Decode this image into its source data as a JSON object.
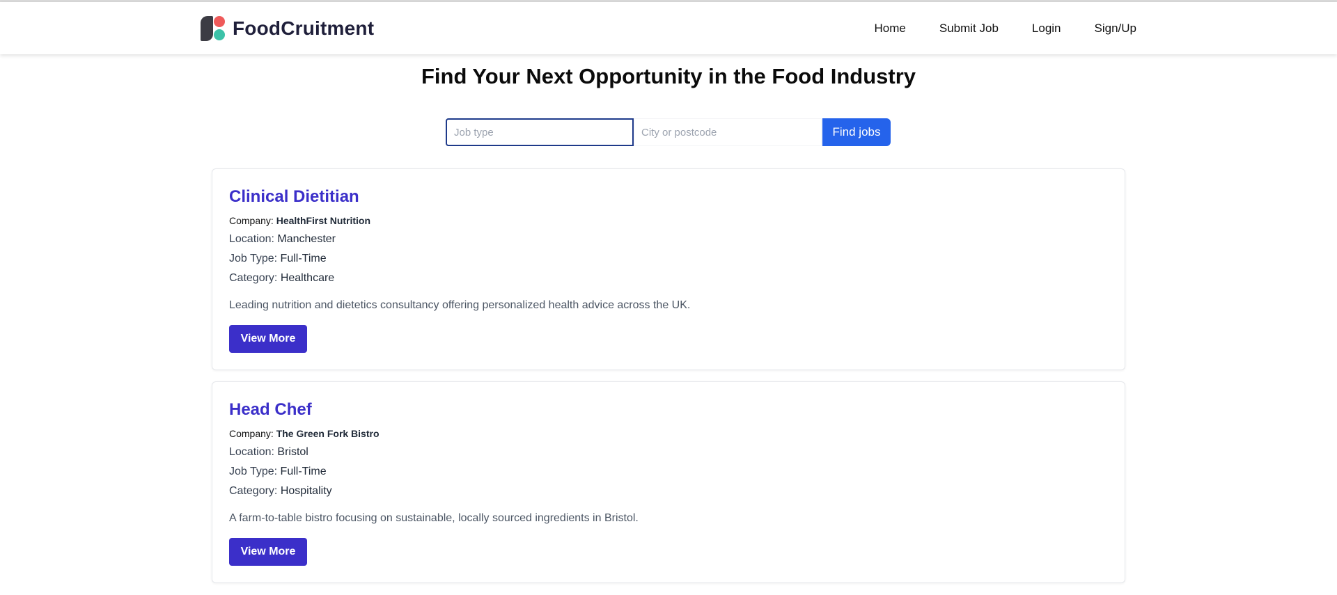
{
  "brand": {
    "name": "FoodCruitment"
  },
  "nav": {
    "items": [
      "Home",
      "Submit Job",
      "Login",
      "Sign/Up"
    ]
  },
  "hero": {
    "title": "Find Your Next Opportunity in the Food Industry"
  },
  "search": {
    "job_placeholder": "Job type",
    "location_placeholder": "City or postcode",
    "button_label": "Find jobs"
  },
  "labels": {
    "company": "Company:",
    "location": "Location:",
    "job_type": "Job Type:",
    "category": "Category:",
    "view_more": "View More"
  },
  "jobs": [
    {
      "title": "Clinical Dietitian",
      "company": "HealthFirst Nutrition",
      "location": "Manchester",
      "job_type": "Full-Time",
      "category": "Healthcare",
      "description": "Leading nutrition and dietetics consultancy offering personalized health advice across the UK."
    },
    {
      "title": "Head Chef",
      "company": "The Green Fork Bistro",
      "location": "Bristol",
      "job_type": "Full-Time",
      "category": "Hospitality",
      "description": "A farm-to-table bistro focusing on sustainable, locally sourced ingredients in Bristol."
    }
  ],
  "colors": {
    "accent": "#3b2fc9",
    "search_button": "#2563eb",
    "logo_red": "#ef5a5a",
    "logo_teal": "#3cc2a8"
  }
}
